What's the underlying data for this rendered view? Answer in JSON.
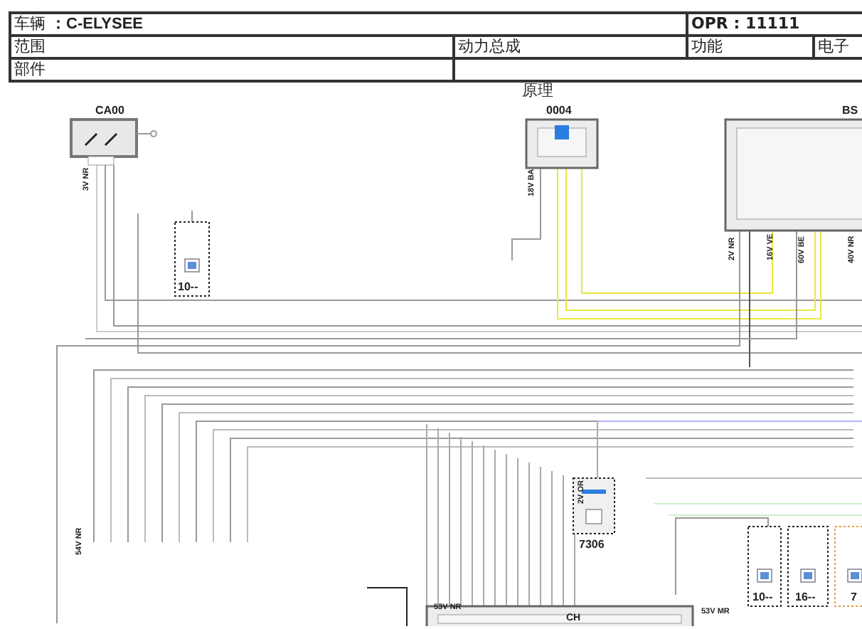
{
  "header": {
    "vehicle_label": "车辆",
    "vehicle": "：C-ELYSEE",
    "opr": "OPR : 11111",
    "range_label": "范围",
    "range": "动力总成",
    "function_label": "功能",
    "function": "电子",
    "part_label": "部件"
  },
  "diagram": {
    "title": "原理",
    "components": [
      {
        "label": "CA00",
        "kind": "switch"
      },
      {
        "label": "10--",
        "kind": "fuse"
      },
      {
        "label": "0004",
        "kind": "module"
      },
      {
        "label": "BS",
        "kind": "module"
      },
      {
        "label": "7306",
        "kind": "sensor"
      },
      {
        "label": "CH",
        "kind": "module"
      },
      {
        "label": "10--",
        "kind": "fuse"
      },
      {
        "label": "16--",
        "kind": "fuse"
      },
      {
        "label": "7",
        "kind": "fuse"
      }
    ],
    "connector_labels": [
      "3V NR",
      "18V BA",
      "2V NR",
      "16V VE",
      "60V BE",
      "40V NR",
      "54V NR",
      "2V OR",
      "53V NR",
      "53V MR"
    ]
  }
}
